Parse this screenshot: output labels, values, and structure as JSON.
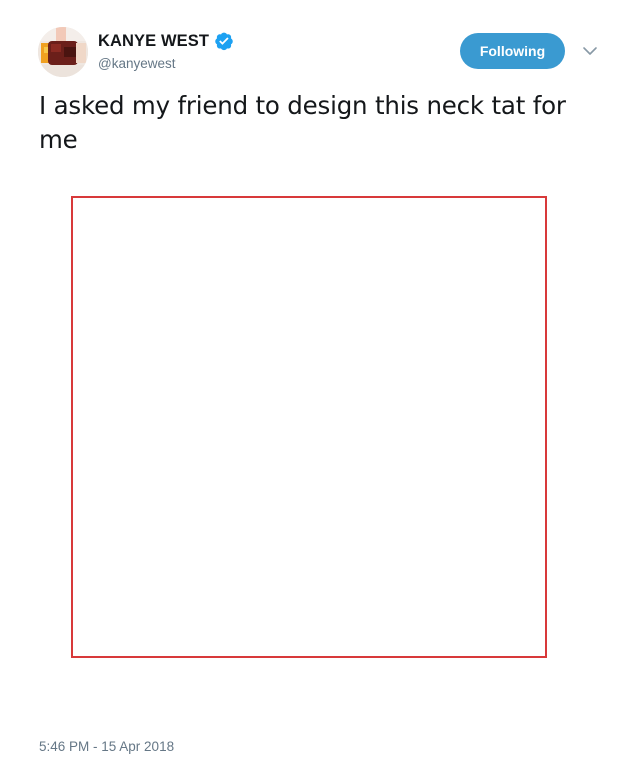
{
  "tweet": {
    "display_name": "KANYE WEST",
    "verified": true,
    "username": "@kanyewest",
    "follow_button_label": "Following",
    "text": "I asked my friend to design this neck tat for me",
    "timestamp": "5:46 PM - 15 Apr 2018"
  },
  "colors": {
    "accent": "#3a9ad1",
    "verified": "#1da1f2",
    "media_border": "#d8393a",
    "secondary_text": "#657786"
  },
  "icons": {
    "verified": "verified-badge-icon",
    "caret": "chevron-down-icon"
  }
}
